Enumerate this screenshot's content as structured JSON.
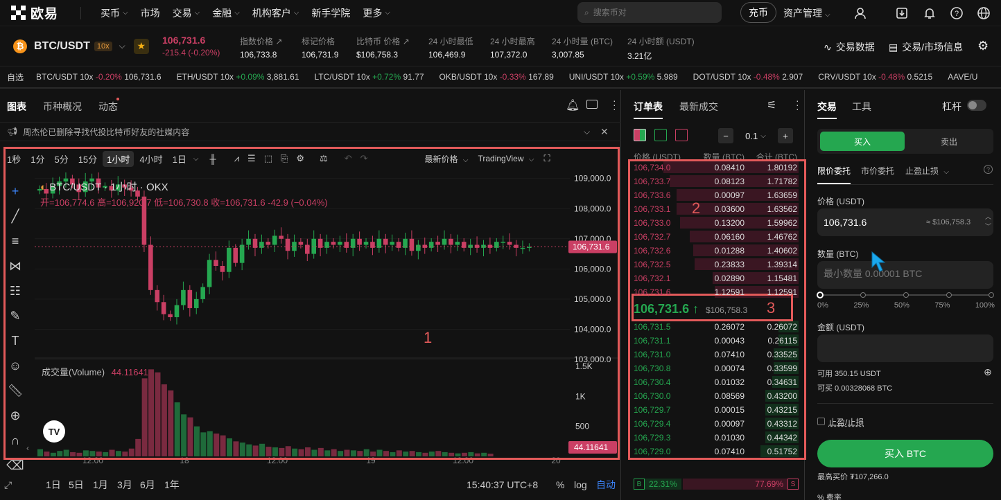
{
  "nav": {
    "logo": "欧易",
    "items": [
      "买币",
      "市场",
      "交易",
      "金融",
      "机构客户",
      "新手学院",
      "更多"
    ],
    "search_placeholder": "搜索币对",
    "deposit": "充币",
    "assets": "资产管理"
  },
  "ticker": {
    "pair": "BTC/USDT",
    "leverage": "10x",
    "last_price": "106,731.6",
    "change": "-215.4 (-0.20%)",
    "stats": [
      {
        "label": "指数价格",
        "value": "106,733.8"
      },
      {
        "label": "标记价格",
        "value": "106,731.9"
      },
      {
        "label": "比特币 价格",
        "value": "$106,758.3"
      },
      {
        "label": "24 小时最低",
        "value": "106,469.9"
      },
      {
        "label": "24 小时最高",
        "value": "107,372.0"
      },
      {
        "label": "24 小时量 (BTC)",
        "value": "3,007.85"
      },
      {
        "label": "24 小时额 (USDT)",
        "value": "3.21亿"
      }
    ],
    "trade_data": "交易数据",
    "market_info": "交易/市场信息"
  },
  "favorites": {
    "label": "自选",
    "items": [
      {
        "name": "BTC/USDT 10x",
        "chg": "-0.20%",
        "px": "106,731.6",
        "dir": "down"
      },
      {
        "name": "ETH/USDT 10x",
        "chg": "+0.09%",
        "px": "3,881.61",
        "dir": "up"
      },
      {
        "name": "LTC/USDT 10x",
        "chg": "+0.72%",
        "px": "91.77",
        "dir": "up"
      },
      {
        "name": "OKB/USDT 10x",
        "chg": "-0.33%",
        "px": "167.89",
        "dir": "down"
      },
      {
        "name": "UNI/USDT 10x",
        "chg": "+0.59%",
        "px": "5.989",
        "dir": "up"
      },
      {
        "name": "DOT/USDT 10x",
        "chg": "-0.48%",
        "px": "2.907",
        "dir": "down"
      },
      {
        "name": "CRV/USDT 10x",
        "chg": "-0.48%",
        "px": "0.5215",
        "dir": "down"
      },
      {
        "name": "AAVE/U",
        "chg": "",
        "px": "",
        "dir": "up"
      }
    ]
  },
  "chart": {
    "tabs": [
      "图表",
      "币种概况",
      "动态"
    ],
    "notice": "周杰伦已删除寻找代投比特币好友的社媒内容",
    "timeframes": [
      "1秒",
      "1分",
      "5分",
      "15分",
      "1小时",
      "4小时",
      "1日"
    ],
    "active_tf": "1小时",
    "price_type": "最新价格",
    "view": "TradingView",
    "legend_title": "BTC/USDT · 1小时 · OKX",
    "ohlc": {
      "o": "开=106,774.6",
      "h": "高=106,920.7",
      "l": "低=106,730.8",
      "c": "收=106,731.6",
      "chg": "-42.9 (−0.04%)"
    },
    "volume_label": "成交量(Volume)",
    "volume_value": "44.11641",
    "price_axis": [
      "109,000.0",
      "108,000.0",
      "107,000.0",
      "106,000.0",
      "105,000.0",
      "104,000.0",
      "103,000.0"
    ],
    "vol_axis": [
      "1.5K",
      "1K",
      "500"
    ],
    "time_axis": [
      "12:00",
      "18",
      "12:00",
      "19",
      "12:00",
      "20"
    ],
    "last_tag": "106,731.6",
    "vol_tag": "44.11641",
    "ranges": [
      "1日",
      "5日",
      "1月",
      "3月",
      "6月",
      "1年"
    ],
    "clock": "15:40:37 UTC+8",
    "pct": "%",
    "log": "log",
    "auto": "自动",
    "box_labels": [
      "1",
      "2",
      "3"
    ]
  },
  "chart_data": {
    "type": "candlestick",
    "interval": "1h",
    "candles_close": [
      108650,
      108500,
      108750,
      108900,
      109000,
      108800,
      108550,
      108900,
      109000,
      108700,
      108750,
      108600,
      108800,
      108700,
      108600,
      108400,
      106800,
      105300,
      104900,
      104500,
      104400,
      104800,
      105300,
      104700,
      105000,
      105400,
      106300,
      106100,
      105900,
      106700,
      106200,
      106800,
      107000,
      106700,
      106900,
      106800,
      107100,
      107000,
      106600,
      106900,
      106800,
      106500,
      107000,
      106700,
      106900,
      106800,
      106900,
      106700,
      107000,
      106800,
      106900,
      106700,
      107000,
      106800,
      106900,
      106700,
      107000,
      106600,
      106800,
      106700,
      106900,
      106800,
      107000,
      106800,
      106900,
      106700,
      106800,
      106700,
      106800,
      106700,
      106900,
      106900,
      106800,
      106700,
      106700,
      106731.6
    ],
    "volume": [
      120,
      80,
      60,
      90,
      110,
      70,
      60,
      100,
      90,
      80,
      70,
      110,
      90,
      80,
      130,
      290,
      1300,
      1450,
      1400,
      1200,
      1100,
      900,
      700,
      650,
      500,
      400,
      420,
      380,
      350,
      300,
      250,
      230,
      200,
      180,
      210,
      160,
      150,
      140,
      170,
      130,
      120,
      150,
      110,
      140,
      100,
      120,
      90,
      110,
      100,
      90,
      120,
      80,
      110,
      90,
      70,
      100,
      80,
      90,
      70,
      60,
      80,
      90,
      70,
      60,
      50,
      60,
      70,
      50,
      60,
      44.11641
    ]
  },
  "orderbook": {
    "tabs": [
      "订单表",
      "最新成交"
    ],
    "step": "0.1",
    "headers": [
      "价格 (USDT)",
      "数量 (BTC)",
      "合计 (BTC)"
    ],
    "asks": [
      {
        "p": "106,734.0",
        "q": "0.08410",
        "t": "1.80192",
        "w": 0.82
      },
      {
        "p": "106,733.7",
        "q": "0.08123",
        "t": "1.71782",
        "w": 0.78
      },
      {
        "p": "106,733.6",
        "q": "0.00097",
        "t": "1.63659",
        "w": 0.74
      },
      {
        "p": "106,733.1",
        "q": "0.03600",
        "t": "1.63562",
        "w": 0.74
      },
      {
        "p": "106,733.0",
        "q": "0.13200",
        "t": "1.59962",
        "w": 0.72
      },
      {
        "p": "106,732.7",
        "q": "0.06160",
        "t": "1.46762",
        "w": 0.66
      },
      {
        "p": "106,732.6",
        "q": "0.01288",
        "t": "1.40602",
        "w": 0.64
      },
      {
        "p": "106,732.5",
        "q": "0.23833",
        "t": "1.39314",
        "w": 0.63
      },
      {
        "p": "106,732.1",
        "q": "0.02890",
        "t": "1.15481",
        "w": 0.52
      },
      {
        "p": "106,731.6",
        "q": "1.12591",
        "t": "1.12591",
        "w": 0.51
      }
    ],
    "mid_price": "106,731.6 ↑",
    "mid_usd": "$106,758.3",
    "bids": [
      {
        "p": "106,731.5",
        "q": "0.26072",
        "t": "0.26072",
        "w": 0.12
      },
      {
        "p": "106,731.1",
        "q": "0.00043",
        "t": "0.26115",
        "w": 0.12
      },
      {
        "p": "106,731.0",
        "q": "0.07410",
        "t": "0.33525",
        "w": 0.15
      },
      {
        "p": "106,730.8",
        "q": "0.00074",
        "t": "0.33599",
        "w": 0.15
      },
      {
        "p": "106,730.4",
        "q": "0.01032",
        "t": "0.34631",
        "w": 0.16
      },
      {
        "p": "106,730.0",
        "q": "0.08569",
        "t": "0.43200",
        "w": 0.2
      },
      {
        "p": "106,729.7",
        "q": "0.00015",
        "t": "0.43215",
        "w": 0.2
      },
      {
        "p": "106,729.4",
        "q": "0.00097",
        "t": "0.43312",
        "w": 0.2
      },
      {
        "p": "106,729.3",
        "q": "0.01030",
        "t": "0.44342",
        "w": 0.2
      },
      {
        "p": "106,729.0",
        "q": "0.07410",
        "t": "0.51752",
        "w": 0.23
      }
    ],
    "buy_ratio": "22.31%",
    "sell_ratio": "77.69%"
  },
  "trade": {
    "tabs": [
      "交易",
      "工具"
    ],
    "leverage": "杠杆",
    "buy": "买入",
    "sell": "卖出",
    "order_types": [
      "限价委托",
      "市价委托",
      "止盈止损"
    ],
    "price_label": "价格 (USDT)",
    "price_value": "106,731.6",
    "price_usd": "≈ $106,758.3",
    "qty_label": "数量 (BTC)",
    "qty_placeholder": "最小数量 0.00001 BTC",
    "slider": [
      "0%",
      "25%",
      "50%",
      "75%",
      "100%"
    ],
    "amount_label": "金额 (USDT)",
    "avail": "可用 350.15 USDT",
    "canbuy": "可买 0.00328068 BTC",
    "tpsl": "止盈/止损",
    "buy_btn": "买入 BTC",
    "max_buy": "最高买价 ₮107,266.0",
    "fee": "费率"
  }
}
